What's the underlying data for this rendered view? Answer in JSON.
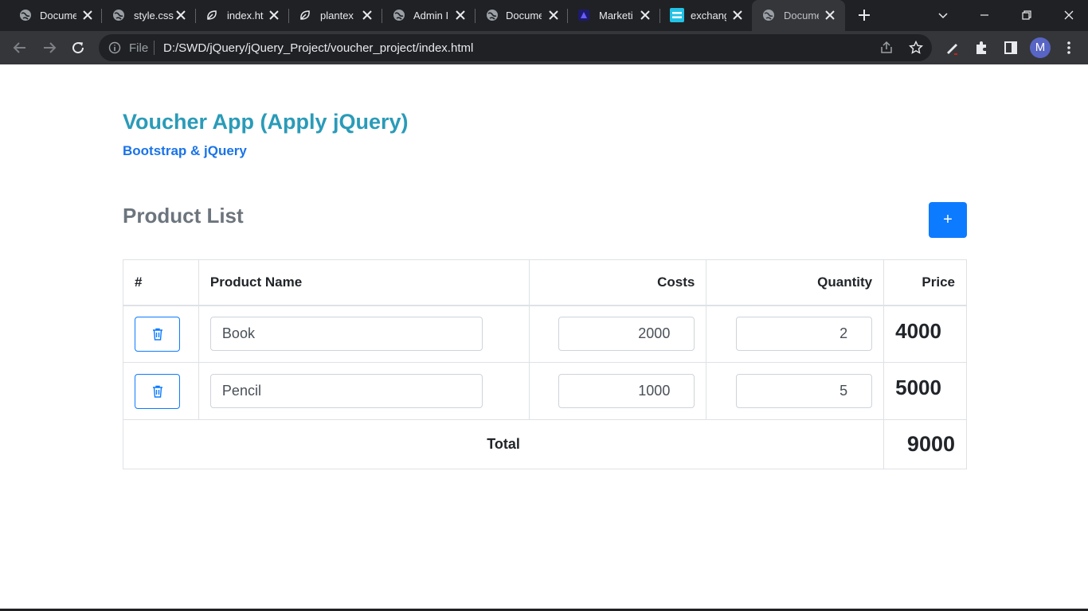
{
  "browser": {
    "tabs": [
      {
        "label": "Docume",
        "icon": "globe-icon"
      },
      {
        "label": "style.css",
        "icon": "globe-icon"
      },
      {
        "label": "index.ht",
        "icon": "leaf-icon"
      },
      {
        "label": "plantex",
        "icon": "leaf-icon"
      },
      {
        "label": "Admin I",
        "icon": "globe-icon"
      },
      {
        "label": "Docume",
        "icon": "globe-icon"
      },
      {
        "label": "Marketi",
        "icon": "marketing-icon"
      },
      {
        "label": "exchang",
        "icon": "exchange-icon"
      },
      {
        "label": "Docume",
        "icon": "globe-icon",
        "active": true
      }
    ],
    "omnibox": {
      "scheme_label": "File",
      "url": "D:/SWD/jQuery/jQuery_Project/voucher_project/index.html"
    },
    "profile_initial": "M"
  },
  "page": {
    "title": "Voucher App (Apply jQuery)",
    "subtitle": "Bootstrap & jQuery",
    "section_title": "Product List",
    "add_button_label": "+",
    "table": {
      "headers": [
        "#",
        "Product Name",
        "Costs",
        "Quantity",
        "Price"
      ],
      "rows": [
        {
          "name": "Book",
          "cost": "2000",
          "quantity": "2",
          "price": "4000"
        },
        {
          "name": "Pencil",
          "cost": "1000",
          "quantity": "5",
          "price": "5000"
        }
      ],
      "total_label": "Total",
      "total_value": "9000"
    }
  },
  "colors": {
    "title": "#2a9bb8",
    "subtitle": "#1a73e8",
    "primary": "#0d7bff",
    "chrome_dark": "#202124",
    "chrome_toolbar": "#35363a"
  }
}
